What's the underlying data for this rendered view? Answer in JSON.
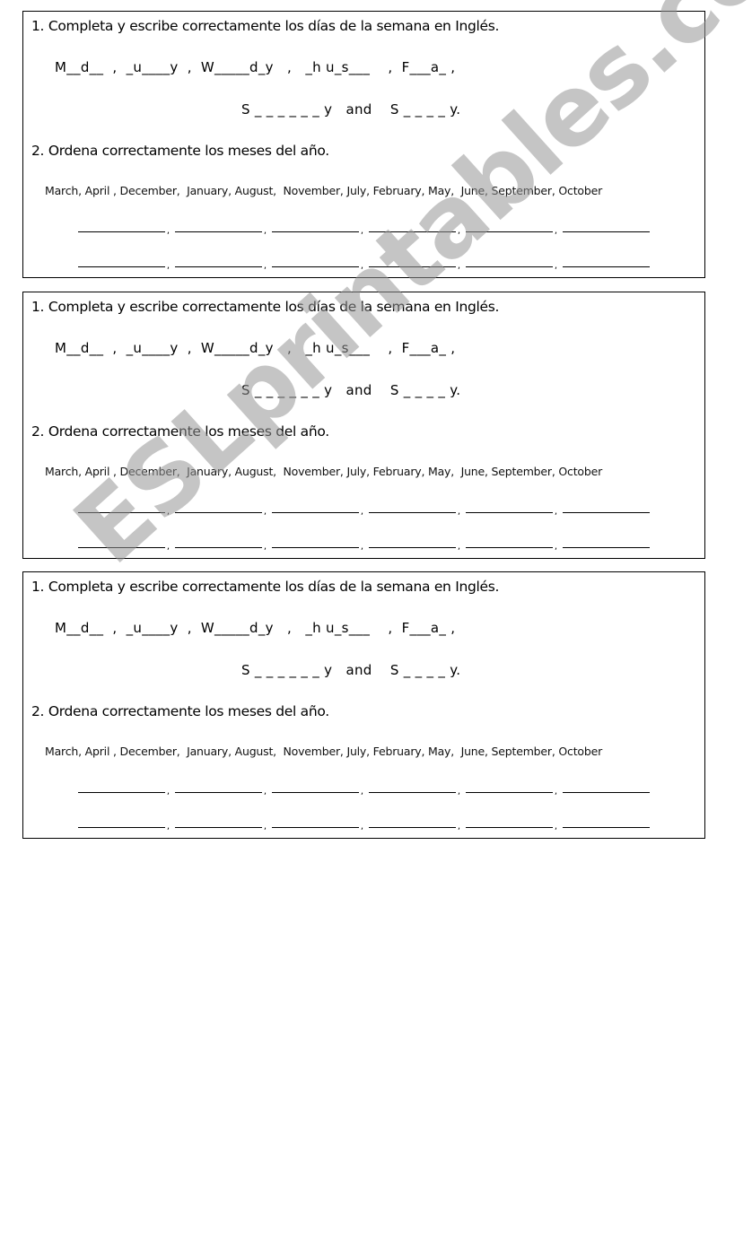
{
  "worksheet": {
    "exercise1_title": "1. Completa y escribe correctamente los días de la semana en Inglés.",
    "days_line1": "M__d__  ,  _u____y  ,  W_____d_y   ,   _h u_s___    ,  F___a_ ,",
    "days_line2": "S _ _ _ _ _ _ y   and    S _ _ _ _ y.",
    "exercise2_title": "2. Ordena correctamente los meses del año.",
    "months_list": "March, April , December,  January, August,  November, July, February, May,  June, September, October",
    "blank_comma": ","
  },
  "watermark": {
    "text": "ESLprintables.com",
    "color": "#999999"
  }
}
